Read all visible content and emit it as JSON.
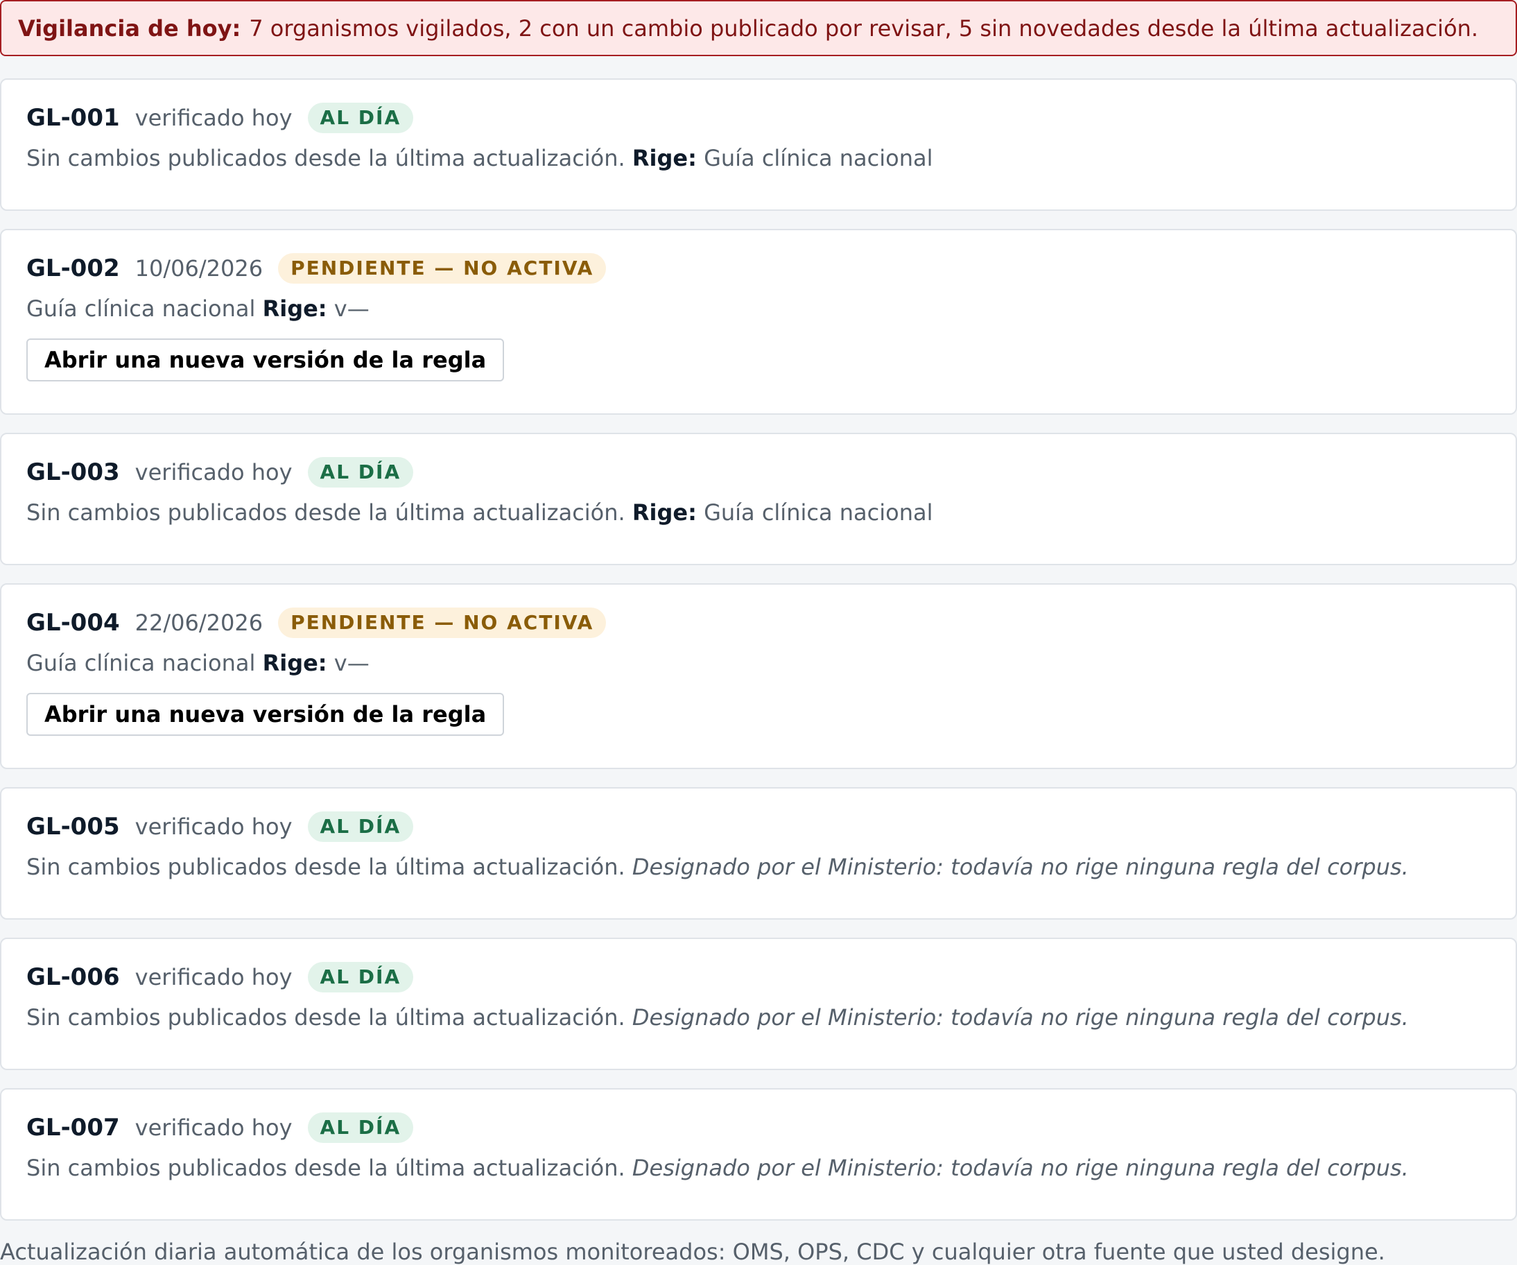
{
  "banner": {
    "label": "Vigilancia de hoy:",
    "text": "7 organismos vigilados, 2 con un cambio publicado por revisar, 5 sin novedades desde la última actualización."
  },
  "cards": [
    {
      "code": "GL-001",
      "when": "verificado hoy",
      "badge": "AL DÍA",
      "text": "Sin cambios publicados desde la última actualización.",
      "rige_label": "Rige:",
      "rige_value": "Guía clínica nacional"
    },
    {
      "code": "GL-002",
      "when": "10/06/2026",
      "badge": "PENDIENTE — NO ACTIVA",
      "text": "Guía clínica nacional",
      "rige_label": "Rige:",
      "rige_value": "v—",
      "button": "Abrir una nueva versión de la regla"
    },
    {
      "code": "GL-003",
      "when": "verificado hoy",
      "badge": "AL DÍA",
      "text": "Sin cambios publicados desde la última actualización.",
      "rige_label": "Rige:",
      "rige_value": "Guía clínica nacional"
    },
    {
      "code": "GL-004",
      "when": "22/06/2026",
      "badge": "PENDIENTE — NO ACTIVA",
      "text": "Guía clínica nacional",
      "rige_label": "Rige:",
      "rige_value": "v—",
      "button": "Abrir una nueva versión de la regla"
    },
    {
      "code": "GL-005",
      "when": "verificado hoy",
      "badge": "AL DÍA",
      "text": "Sin cambios publicados desde la última actualización.",
      "note": "Designado por el Ministerio: todavía no rige ninguna regla del corpus."
    },
    {
      "code": "GL-006",
      "when": "verificado hoy",
      "badge": "AL DÍA",
      "text": "Sin cambios publicados desde la última actualización.",
      "note": "Designado por el Ministerio: todavía no rige ninguna regla del corpus."
    },
    {
      "code": "GL-007",
      "when": "verificado hoy",
      "badge": "AL DÍA",
      "text": "Sin cambios publicados desde la última actualización.",
      "note": "Designado por el Ministerio: todavía no rige ninguna regla del corpus."
    }
  ],
  "footer": "Actualización diaria automática de los organismos monitoreados: OMS, OPS, CDC y cualquier otra fuente que usted designe.",
  "colors": {
    "ok": "#1b6e46",
    "pending": "#8a5c08",
    "alert": "#a61e22"
  }
}
